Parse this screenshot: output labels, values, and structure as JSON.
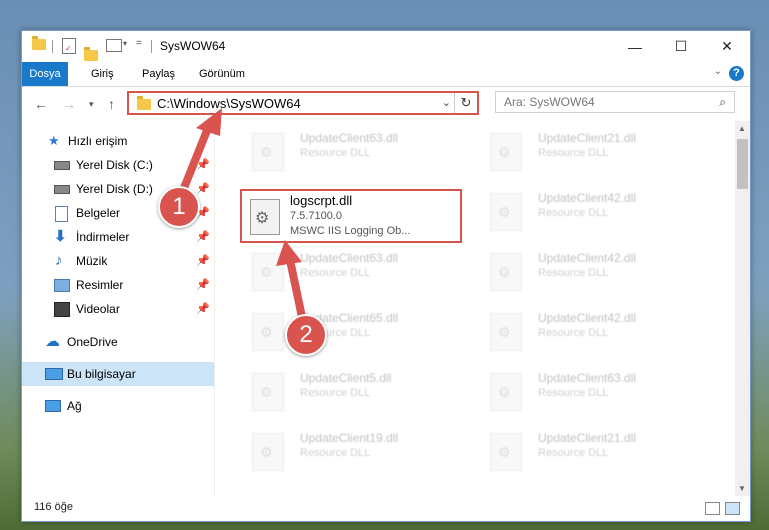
{
  "window": {
    "title": "SysWOW64",
    "minimize": "—",
    "maximize": "☐",
    "close": "✕"
  },
  "ribbon": {
    "tabs": [
      "Dosya",
      "Giriş",
      "Paylaş",
      "Görünüm"
    ],
    "help": "?"
  },
  "nav": {
    "address": "C:\\Windows\\SysWOW64",
    "search_placeholder": "Ara: SysWOW64"
  },
  "sidebar": {
    "items": [
      {
        "label": "Hızlı erişim",
        "icon": "star-icon",
        "pinned": false
      },
      {
        "label": "Yerel Disk (C:)",
        "icon": "drive-icon",
        "pinned": true
      },
      {
        "label": "Yerel Disk (D:)",
        "icon": "drive-icon",
        "pinned": true
      },
      {
        "label": "Belgeler",
        "icon": "documents-icon",
        "pinned": true
      },
      {
        "label": "İndirmeler",
        "icon": "download-icon",
        "pinned": true
      },
      {
        "label": "Müzik",
        "icon": "music-icon",
        "pinned": true
      },
      {
        "label": "Resimler",
        "icon": "pictures-icon",
        "pinned": true
      },
      {
        "label": "Videolar",
        "icon": "videos-icon",
        "pinned": true
      },
      {
        "label": "OneDrive",
        "icon": "cloud-icon",
        "pinned": false
      },
      {
        "label": "Bu bilgisayar",
        "icon": "computer-icon",
        "pinned": false,
        "selected": true
      },
      {
        "label": "Ağ",
        "icon": "network-icon",
        "pinned": false
      }
    ]
  },
  "files": {
    "highlighted": {
      "name": "logscrpt.dll",
      "version": "7.5.7100.0",
      "description": "MSWC IIS Logging Ob..."
    },
    "background_tiles": [
      {
        "name": "UpdateClient63.dll",
        "type": "Resource DLL"
      },
      {
        "name": "UpdateClient21.dll",
        "type": "Resource DLL"
      },
      {
        "name": "UpdateClient42.dll",
        "type": "Resource DLL"
      },
      {
        "name": "UpdateClient63.dll",
        "type": "Resource DLL"
      },
      {
        "name": "UpdateClient42.dll",
        "type": "Resource DLL"
      },
      {
        "name": "UpdateClient65.dll",
        "type": "Resource DLL"
      },
      {
        "name": "UpdateClient42.dll",
        "type": "Resource DLL"
      },
      {
        "name": "UpdateClient5.dll",
        "type": "Resource DLL"
      },
      {
        "name": "UpdateClient63.dll",
        "type": "Resource DLL"
      },
      {
        "name": "UpdateClient19.dll",
        "type": "Resource DLL"
      },
      {
        "name": "UpdateClient21.dll",
        "type": "Resource DLL"
      }
    ]
  },
  "status": {
    "count": "116 öğe"
  },
  "annotations": {
    "step1": "1",
    "step2": "2",
    "color": "#d9534f"
  },
  "colors": {
    "accent": "#1979ca",
    "selected": "#cce4f7",
    "highlight": "#d9534f"
  }
}
